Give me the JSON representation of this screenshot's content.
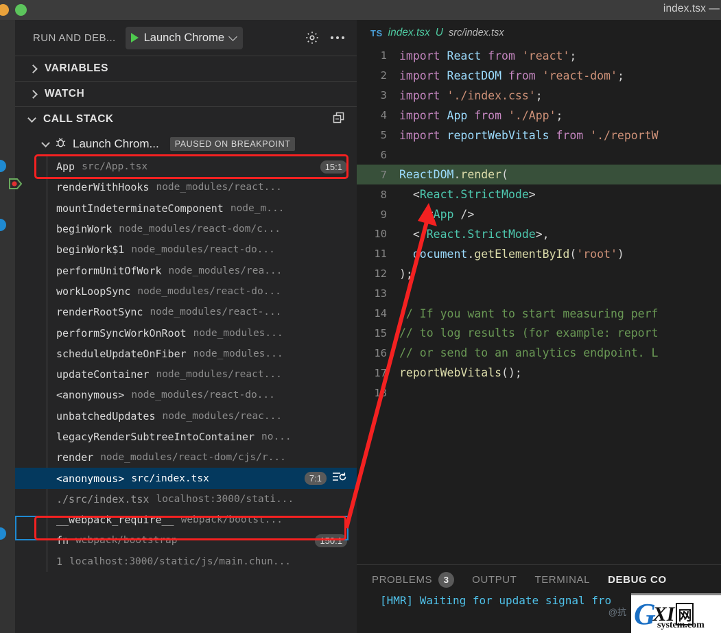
{
  "titlebar": {
    "title": "index.tsx —"
  },
  "debug_panel": {
    "header_label": "RUN AND DEB...",
    "launch_config": "Launch Chrome",
    "gear_icon": "gear-icon",
    "more_icon": "ellipsis-icon",
    "sections": [
      {
        "label": "VARIABLES",
        "expanded": false
      },
      {
        "label": "WATCH",
        "expanded": false
      },
      {
        "label": "CALL STACK",
        "expanded": true
      }
    ],
    "session": {
      "name": "Launch Chrom...",
      "status": "PAUSED ON BREAKPOINT",
      "icon": "bug-icon"
    },
    "call_stack": [
      {
        "fn": "App",
        "src": "src/App.tsx",
        "pos": "15:1",
        "highlight": "annotated"
      },
      {
        "fn": "renderWithHooks",
        "src": "node_modules/react...",
        "pos": ""
      },
      {
        "fn": "mountIndeterminateComponent",
        "src": "node_m...",
        "pos": ""
      },
      {
        "fn": "beginWork",
        "src": "node_modules/react-dom/c...",
        "pos": ""
      },
      {
        "fn": "beginWork$1",
        "src": "node_modules/react-do...",
        "pos": ""
      },
      {
        "fn": "performUnitOfWork",
        "src": "node_modules/rea...",
        "pos": ""
      },
      {
        "fn": "workLoopSync",
        "src": "node_modules/react-do...",
        "pos": ""
      },
      {
        "fn": "renderRootSync",
        "src": "node_modules/react-...",
        "pos": ""
      },
      {
        "fn": "performSyncWorkOnRoot",
        "src": "node_modules...",
        "pos": ""
      },
      {
        "fn": "scheduleUpdateOnFiber",
        "src": "node_modules...",
        "pos": ""
      },
      {
        "fn": "updateContainer",
        "src": "node_modules/react...",
        "pos": ""
      },
      {
        "fn": "<anonymous>",
        "src": "node_modules/react-do...",
        "pos": ""
      },
      {
        "fn": "unbatchedUpdates",
        "src": "node_modules/reac...",
        "pos": ""
      },
      {
        "fn": "legacyRenderSubtreeIntoContainer",
        "src": "no...",
        "pos": ""
      },
      {
        "fn": "render",
        "src": "node_modules/react-dom/cjs/r...",
        "pos": ""
      },
      {
        "fn": "<anonymous>",
        "src": "src/index.tsx",
        "pos": "7:1",
        "highlight": "selected",
        "restart_icon": "restart-frame-icon"
      },
      {
        "fn": "./src/index.tsx",
        "src": "localhost:3000/stati...",
        "pos": "",
        "dim": true
      },
      {
        "fn": "__webpack_require__",
        "src": "webpack/bootst...",
        "pos": ""
      },
      {
        "fn": "fn",
        "src": "webpack/bootstrap",
        "pos": "150:1"
      },
      {
        "fn": "1",
        "src": "localhost:3000/static/js/main.chun...",
        "pos": "",
        "dim": true
      }
    ]
  },
  "editor": {
    "breadcrumb": {
      "badge": "TS",
      "file": "index.tsx",
      "modified": "U",
      "path": "src/index.tsx"
    },
    "current_line": 7,
    "lines": [
      {
        "n": "1",
        "tokens": [
          [
            "tk-kw",
            "import "
          ],
          [
            "tk-var",
            "React"
          ],
          [
            "tk-pl",
            " "
          ],
          [
            "tk-kw",
            "from"
          ],
          [
            "tk-pl",
            " "
          ],
          [
            "tk-str",
            "'react'"
          ],
          [
            "tk-pl",
            ";"
          ]
        ]
      },
      {
        "n": "2",
        "tokens": [
          [
            "tk-kw",
            "import "
          ],
          [
            "tk-var",
            "ReactDOM"
          ],
          [
            "tk-pl",
            " "
          ],
          [
            "tk-kw",
            "from"
          ],
          [
            "tk-pl",
            " "
          ],
          [
            "tk-str",
            "'react-dom'"
          ],
          [
            "tk-pl",
            ";"
          ]
        ]
      },
      {
        "n": "3",
        "tokens": [
          [
            "tk-kw",
            "import "
          ],
          [
            "tk-str",
            "'./index.css'"
          ],
          [
            "tk-pl",
            ";"
          ]
        ]
      },
      {
        "n": "4",
        "tokens": [
          [
            "tk-kw",
            "import "
          ],
          [
            "tk-var",
            "App"
          ],
          [
            "tk-pl",
            " "
          ],
          [
            "tk-kw",
            "from"
          ],
          [
            "tk-pl",
            " "
          ],
          [
            "tk-str",
            "'./App'"
          ],
          [
            "tk-pl",
            ";"
          ]
        ]
      },
      {
        "n": "5",
        "tokens": [
          [
            "tk-kw",
            "import "
          ],
          [
            "tk-var",
            "reportWebVitals"
          ],
          [
            "tk-pl",
            " "
          ],
          [
            "tk-kw",
            "from"
          ],
          [
            "tk-pl",
            " "
          ],
          [
            "tk-str",
            "'./reportW"
          ]
        ]
      },
      {
        "n": "6",
        "tokens": []
      },
      {
        "n": "7",
        "tokens": [
          [
            "tk-var",
            "ReactDOM"
          ],
          [
            "tk-pl",
            "."
          ],
          [
            "tk-fn",
            "render"
          ],
          [
            "tk-pl",
            "("
          ]
        ],
        "current": true
      },
      {
        "n": "8",
        "tokens": [
          [
            "tk-pl",
            "  <"
          ],
          [
            "tk-tag",
            "React.StrictMode"
          ],
          [
            "tk-pl",
            ">"
          ]
        ]
      },
      {
        "n": "9",
        "tokens": [
          [
            "tk-pl",
            "    <"
          ],
          [
            "tk-tag",
            "App"
          ],
          [
            "tk-pl",
            " />"
          ]
        ]
      },
      {
        "n": "10",
        "tokens": [
          [
            "tk-pl",
            "  </"
          ],
          [
            "tk-tag",
            "React.StrictMode"
          ],
          [
            "tk-pl",
            ">,"
          ]
        ]
      },
      {
        "n": "11",
        "tokens": [
          [
            "tk-pl",
            "  "
          ],
          [
            "tk-var",
            "document"
          ],
          [
            "tk-pl",
            "."
          ],
          [
            "tk-fn",
            "getElementById"
          ],
          [
            "tk-pl",
            "("
          ],
          [
            "tk-str",
            "'root'"
          ],
          [
            "tk-pl",
            ")"
          ]
        ]
      },
      {
        "n": "12",
        "tokens": [
          [
            "tk-pl",
            ");"
          ]
        ]
      },
      {
        "n": "13",
        "tokens": []
      },
      {
        "n": "14",
        "tokens": [
          [
            "tk-cmt",
            "// If you want to start measuring perf"
          ]
        ]
      },
      {
        "n": "15",
        "tokens": [
          [
            "tk-cmt",
            "// to log results (for example: report"
          ]
        ]
      },
      {
        "n": "16",
        "tokens": [
          [
            "tk-cmt",
            "// or send to an analytics endpoint. L"
          ]
        ]
      },
      {
        "n": "17",
        "tokens": [
          [
            "tk-fn",
            "reportWebVitals"
          ],
          [
            "tk-pl",
            "();"
          ]
        ]
      },
      {
        "n": "18",
        "tokens": []
      }
    ]
  },
  "bottom_panel": {
    "tabs": [
      {
        "label": "PROBLEMS",
        "badge": "3",
        "active": false
      },
      {
        "label": "OUTPUT",
        "badge": "",
        "active": false
      },
      {
        "label": "TERMINAL",
        "badge": "",
        "active": false
      },
      {
        "label": "DEBUG CO",
        "badge": "",
        "active": true
      }
    ],
    "console_text": "[HMR] Waiting for update signal fro"
  },
  "watermark": {
    "g": "G",
    "xi": "XI",
    "box": "网",
    "sub": "system.com",
    "cn": "@抗"
  },
  "colors": {
    "accent_blue": "#04395e",
    "annotation_red": "#f42121",
    "paused_line": "#38503a",
    "selection_border": "#1f8ad2"
  }
}
